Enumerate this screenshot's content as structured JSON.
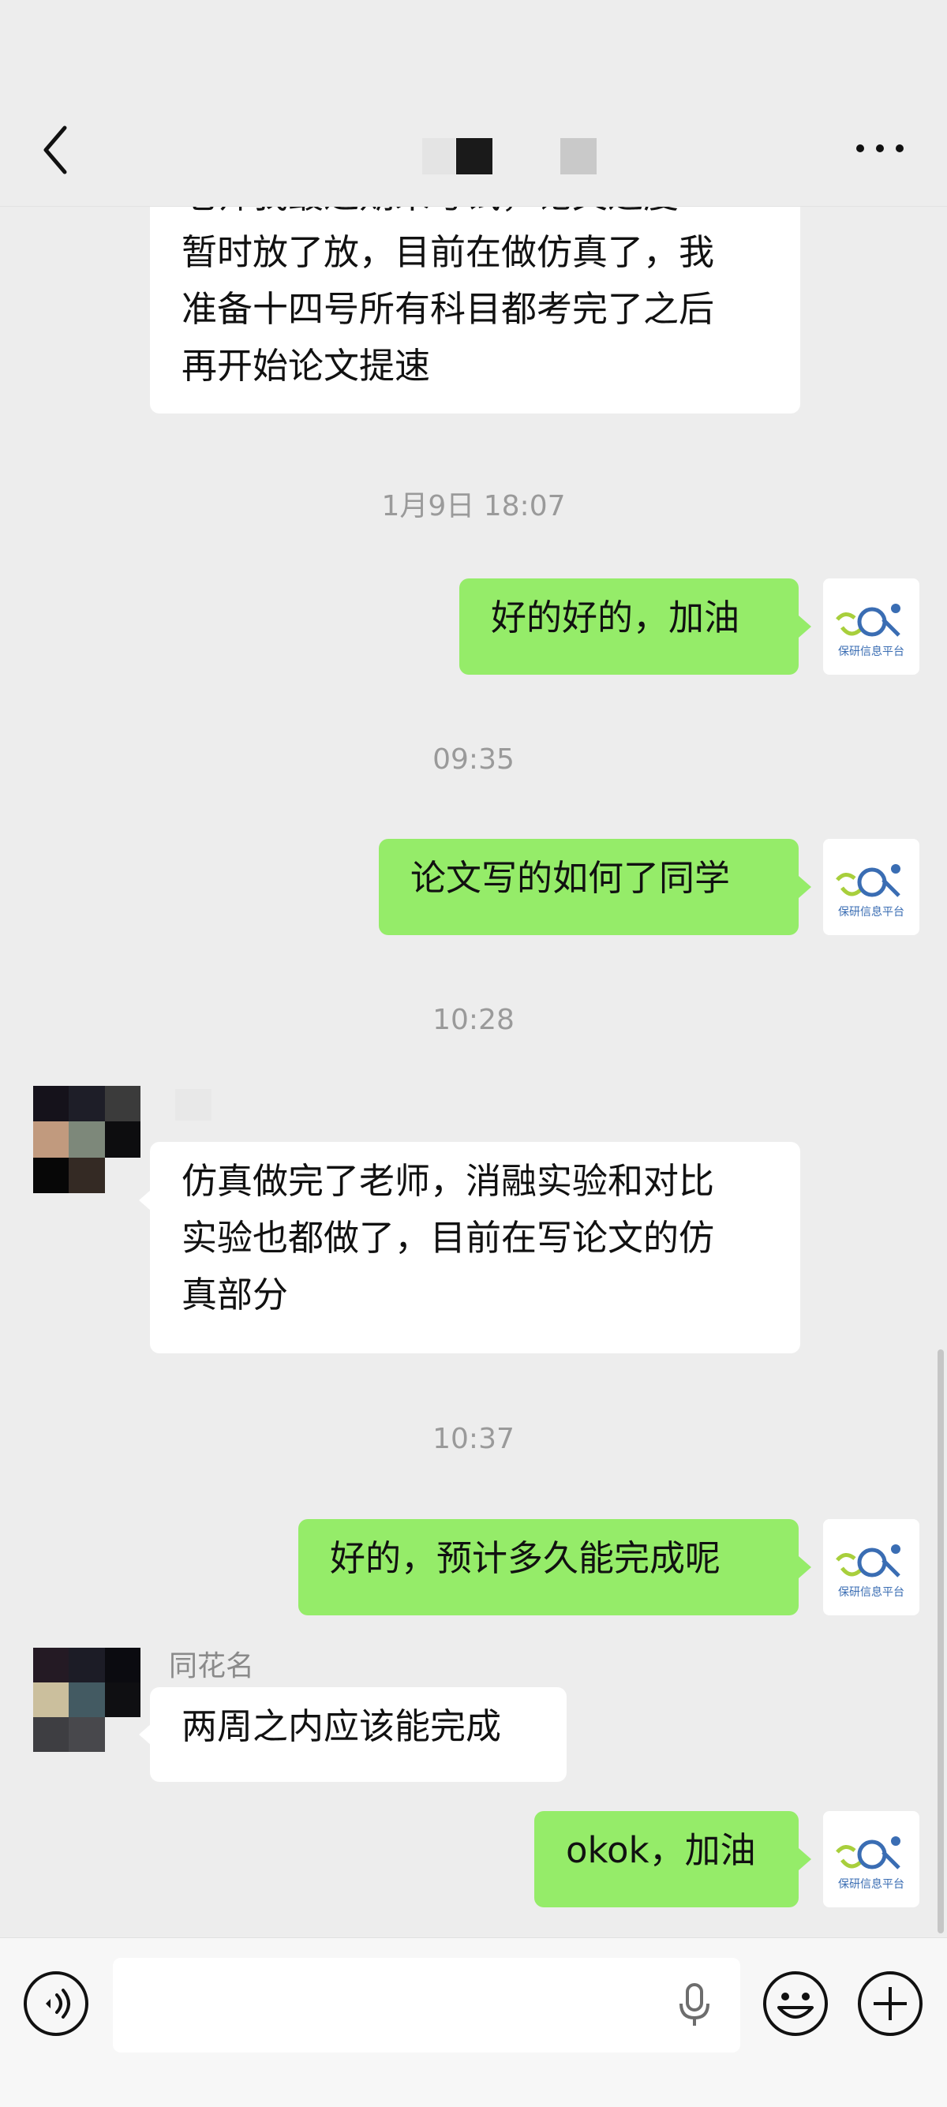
{
  "messages": [
    {
      "id": "m1",
      "side": "in",
      "lines": [
        "老师我最近期末考试，论文进度",
        "暂时放了放，目前在做仿真了，我",
        "准备十四号所有科目都考完了之后",
        "再开始论文提速"
      ]
    },
    {
      "id": "t1",
      "type": "time",
      "text": "1月9日 18:07"
    },
    {
      "id": "m2",
      "side": "out",
      "lines": [
        "好的好的，加油"
      ]
    },
    {
      "id": "t2",
      "type": "time",
      "text": "09:35"
    },
    {
      "id": "m3",
      "side": "out",
      "lines": [
        "论文写的如何了同学"
      ]
    },
    {
      "id": "t3",
      "type": "time",
      "text": "10:28"
    },
    {
      "id": "m4",
      "side": "in",
      "lines": [
        "仿真做完了老师，消融实验和对比",
        "实验也都做了，目前在写论文的仿",
        "真部分"
      ]
    },
    {
      "id": "t4",
      "type": "time",
      "text": "10:37"
    },
    {
      "id": "m5",
      "side": "out",
      "lines": [
        "好的，预计多久能完成呢"
      ]
    },
    {
      "id": "m6",
      "side": "in",
      "sender": "同花名",
      "lines": [
        "两周之内应该能完成"
      ]
    },
    {
      "id": "m7",
      "side": "out",
      "lines": [
        "okok，加油"
      ]
    }
  ],
  "self_avatar_label": "保研信息平台",
  "icons": {
    "back": "back-chevron-icon",
    "more": "more-dots-icon",
    "voice": "voice-toggle-icon",
    "mic": "microphone-icon",
    "emoji": "emoji-icon",
    "plus": "plus-icon"
  },
  "input": {
    "value": "",
    "placeholder": ""
  },
  "colors": {
    "background": "#ededed",
    "out_bubble": "#95ec69",
    "in_bubble": "#ffffff",
    "timestamp": "#9a9a9a"
  }
}
